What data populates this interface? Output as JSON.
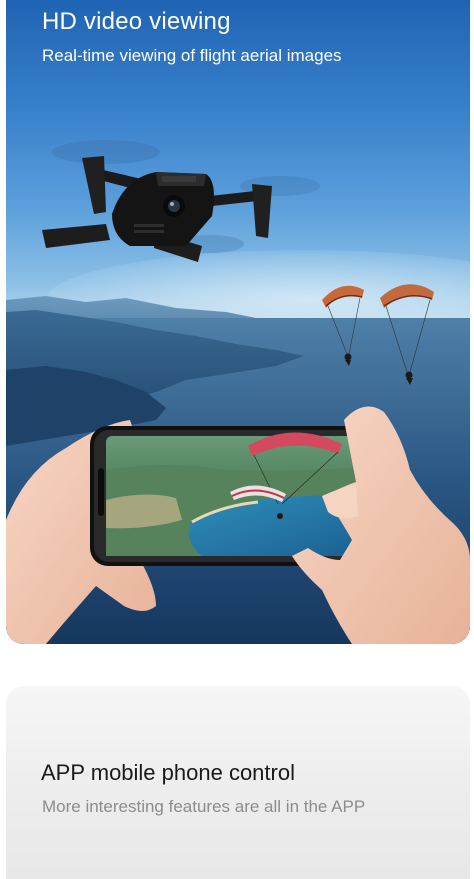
{
  "hero": {
    "title": "HD video viewing",
    "subtitle": "Real-time viewing of flight aerial images"
  },
  "card": {
    "title": "APP mobile phone control",
    "subtitle": "More interesting features are all in the APP"
  },
  "icons": {
    "drone": "drone-icon",
    "paraglider": "paraglider-icon",
    "smartphone": "smartphone-icon",
    "hand": "hand-icon"
  },
  "colors": {
    "sky_top": "#1f64b4",
    "sky_haze": "#b9d9ee",
    "sea": "#173e68",
    "canopy_orange": "#c9693a",
    "canopy_red": "#c7333f",
    "card_bg": "#ececec",
    "title_text": "#1a1a1a",
    "subtitle_text": "#8c8c8c"
  }
}
